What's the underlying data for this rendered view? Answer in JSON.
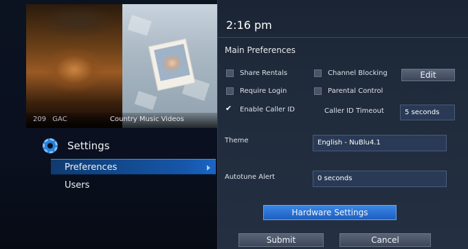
{
  "video": {
    "channel_number": "209",
    "channel_name": "GAC",
    "program_title": "Country Music Videos"
  },
  "menu": {
    "title": "Settings",
    "icon": "gear-icon",
    "items": [
      {
        "label": "Preferences",
        "selected": true
      },
      {
        "label": "Users",
        "selected": false
      }
    ]
  },
  "panel": {
    "time": "2:16 pm",
    "section_title": "Main Preferences",
    "options": [
      {
        "label": "Share Rentals",
        "checked": false
      },
      {
        "label": "Require Login",
        "checked": false
      },
      {
        "label": "Enable Caller ID",
        "checked": true
      },
      {
        "label": "Channel Blocking",
        "checked": false
      },
      {
        "label": "Parental Control",
        "checked": false
      }
    ],
    "edit_label": "Edit",
    "caller_id_timeout": {
      "label": "Caller ID Timeout",
      "value": "5 seconds"
    },
    "theme": {
      "label": "Theme",
      "value": "English - NuBlu4.1"
    },
    "autotune": {
      "label": "Autotune Alert",
      "value": "0 seconds"
    },
    "hardware_settings_label": "Hardware Settings",
    "submit_label": "Submit",
    "cancel_label": "Cancel"
  },
  "colors": {
    "highlight": "#1656a8",
    "hardware_button": "#2f7ade",
    "panel_background": "#1f2a3a"
  }
}
